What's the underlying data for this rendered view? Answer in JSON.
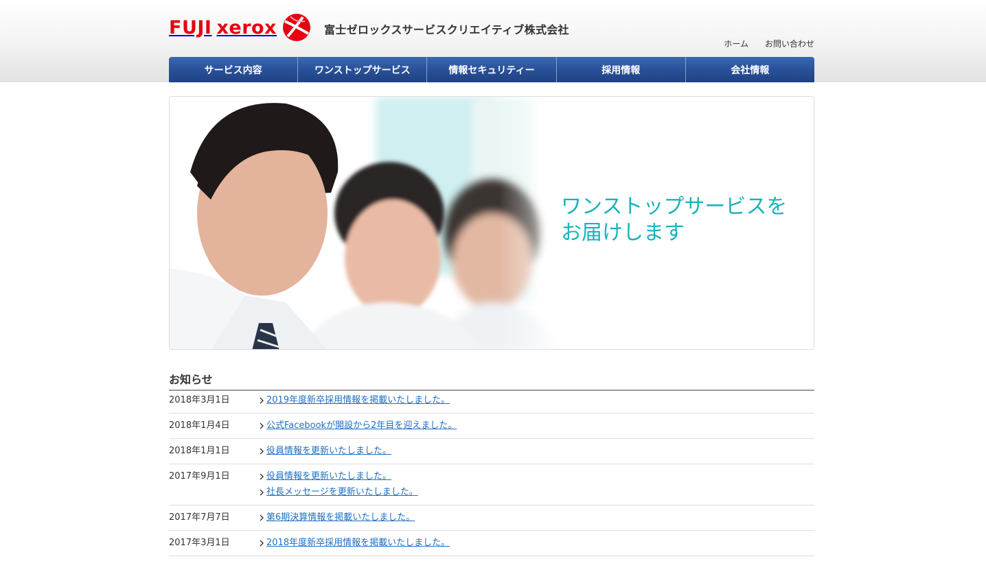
{
  "brand": {
    "logo_text_fuji": "FUJI",
    "logo_text_xerox": "xerox",
    "company_name": "富士ゼロックスサービスクリエイティブ株式会社",
    "brand_red": "#e60012"
  },
  "utility_nav": {
    "home": "ホーム",
    "contact": "お問い合わせ"
  },
  "global_nav": [
    {
      "label": "サービス内容"
    },
    {
      "label": "ワンストップサービス"
    },
    {
      "label": "情報セキュリティー"
    },
    {
      "label": "採用情報"
    },
    {
      "label": "会社情報"
    }
  ],
  "hero": {
    "line1": "ワンストップサービスを",
    "line2": "お届けします",
    "accent": "#17b4ba"
  },
  "news": {
    "title": "お知らせ",
    "items": [
      {
        "date": "2018年3月1日",
        "links": [
          "2019年度新卒採用情報を掲載いたしました。"
        ]
      },
      {
        "date": "2018年1月4日",
        "links": [
          "公式Facebookが開設から2年目を迎えました。"
        ]
      },
      {
        "date": "2018年1月1日",
        "links": [
          "役員情報を更新いたしました。"
        ]
      },
      {
        "date": "2017年9月1日",
        "links": [
          "役員情報を更新いたしました。",
          "社長メッセージを更新いたしました。"
        ]
      },
      {
        "date": "2017年7月7日",
        "links": [
          "第6期決算情報を掲載いたしました。"
        ]
      },
      {
        "date": "2017年3月1日",
        "links": [
          "2018年度新卒採用情報を掲載いたしました。"
        ]
      }
    ],
    "link_color": "#1f6fc0"
  }
}
